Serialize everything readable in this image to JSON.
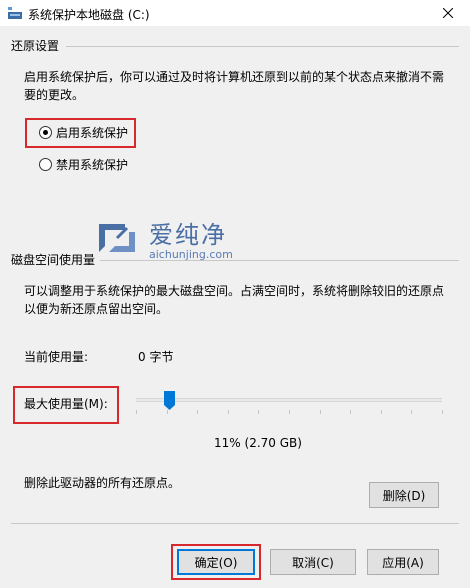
{
  "window": {
    "title": "系统保护本地磁盘 (C:)"
  },
  "restore": {
    "section_label": "还原设置",
    "description_line1": "启用系统保护后，你可以通过及时将计算机还原到以前的某个状态点来撤消不需",
    "description_line2": "要的更改。",
    "options": [
      {
        "label": "启用系统保护",
        "checked": true
      },
      {
        "label": "禁用系统保护",
        "checked": false
      }
    ]
  },
  "watermark": {
    "brand": "爱纯净",
    "url": "aichunjing.com"
  },
  "disk": {
    "section_label": "磁盘空间使用量",
    "description_line1": "可以调整用于系统保护的最大磁盘空间。占满空间时，系统将删除较旧的还原点",
    "description_line2": "以便为新还原点留出空间。",
    "current_label": "当前使用量:",
    "current_value": "0 字节",
    "max_label": "最大使用量(M):",
    "max_percent": 11,
    "max_display": "11% (2.70 GB)",
    "delete_text": "删除此驱动器的所有还原点。",
    "delete_button": "删除(D)"
  },
  "buttons": {
    "ok": "确定(O)",
    "cancel": "取消(C)",
    "apply": "应用(A)"
  },
  "colors": {
    "highlight_border": "#d6282d",
    "default_button_border": "#0078d7",
    "slider_thumb": "#0078d7"
  }
}
